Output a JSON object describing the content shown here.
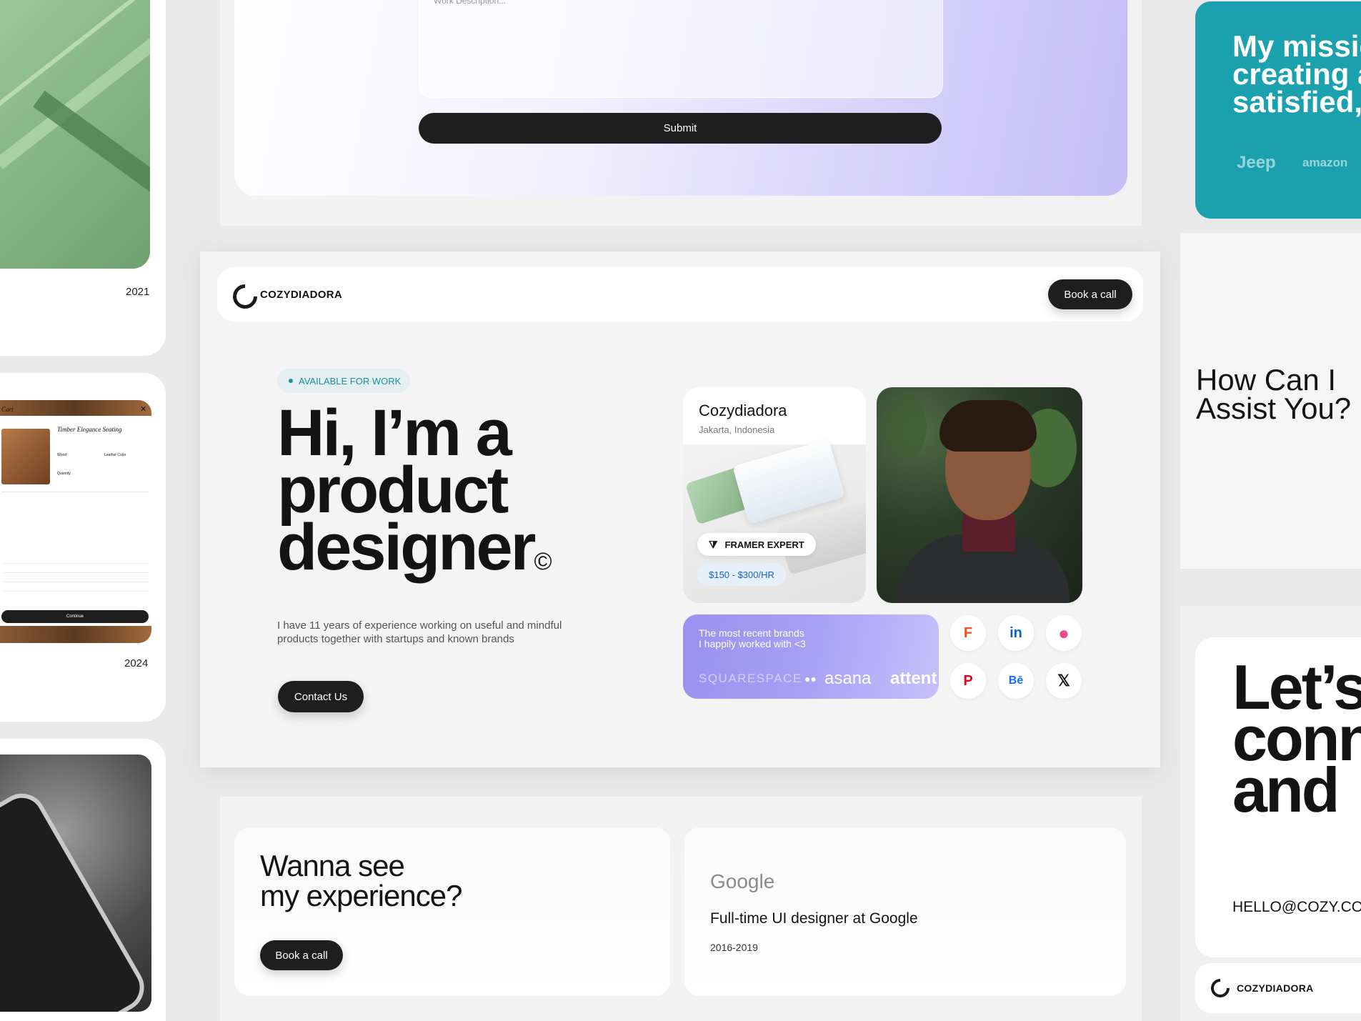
{
  "left_column": {
    "year_top": "2021",
    "year_middle": "2024",
    "cart": {
      "title": "Cart",
      "product": "Timber Elegance Seating",
      "wood_label": "Wood",
      "leather_label": "Leather Color",
      "quantity_label": "Quantity",
      "continue_label": "Continue"
    }
  },
  "form": {
    "placeholder": "Work Description...",
    "submit_label": "Submit"
  },
  "nav": {
    "brand": "COZYDIADORA",
    "cta": "Book a call"
  },
  "hero": {
    "badge": "AVAILABLE FOR WORK",
    "title_line1": "Hi, I’m a",
    "title_line2": "product",
    "title_line3": "designer",
    "copyright_mark": "©",
    "description": "I have 11 years of experience working on useful and mindful products together with startups and known brands",
    "cta": "Contact Us"
  },
  "profile": {
    "name": "Cozydiadora",
    "location": "Jakarta, Indonesia",
    "badge": "FRAMER EXPERT",
    "rate": "$150 - $300/HR"
  },
  "brands": {
    "caption_line1": "The most recent brands",
    "caption_line2": "I happily worked with <3",
    "logos": [
      "SQUARESPACE",
      "asana",
      "attent"
    ]
  },
  "socials": [
    {
      "name": "figma",
      "glyph": "F",
      "color": "#f24e1e"
    },
    {
      "name": "linkedin",
      "glyph": "in",
      "color": "#0a66c2"
    },
    {
      "name": "dribbble",
      "glyph": "●",
      "color": "#ea4c89"
    },
    {
      "name": "pinterest",
      "glyph": "P",
      "color": "#e60023"
    },
    {
      "name": "behance",
      "glyph": "Bē",
      "color": "#1769ff"
    },
    {
      "name": "x",
      "glyph": "𝕏",
      "color": "#111111"
    }
  ],
  "experience": {
    "heading_line1": "Wanna see",
    "heading_line2": "my experience?",
    "cta": "Book a call",
    "company": "Google",
    "role": "Full-time UI designer at Google",
    "years": "2016-2019"
  },
  "right_column": {
    "mission_line1": "My missio",
    "mission_line2": "creating a",
    "mission_line3": "satisfied,",
    "mission_logo1": "Jeep",
    "mission_logo2": "amazon",
    "assist_line1": "How Can I",
    "assist_line2": "Assist You?",
    "connect_line1": "Let’s",
    "connect_line2": "conn",
    "connect_line3": "and",
    "email": "HELLO@COZY.COI",
    "footer_brand": "COZYDIADORA"
  }
}
